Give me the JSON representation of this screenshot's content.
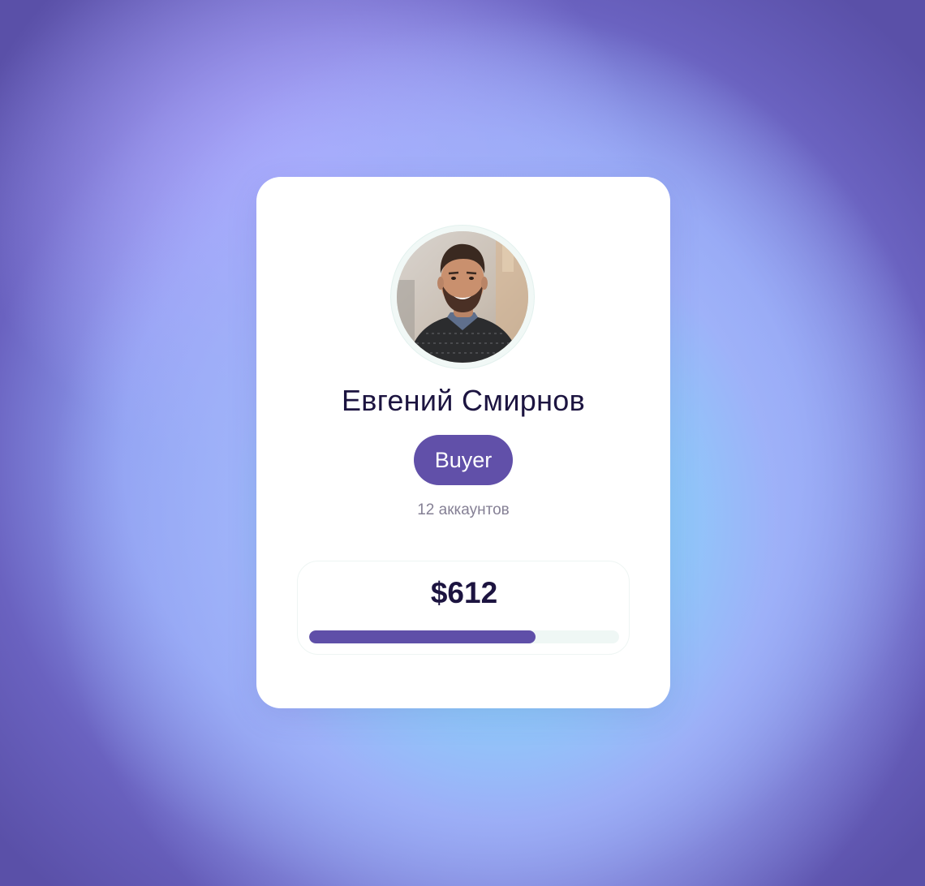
{
  "profile": {
    "name": "Евгений Смирнов",
    "role_badge": "Buyer",
    "accounts_text": "12 аккаунтов",
    "avatar_icon": "user-photo"
  },
  "balance": {
    "amount": "$612",
    "progress_fraction": 0.73
  },
  "colors": {
    "accent": "#6150a9",
    "text_dark": "#1c1440",
    "text_muted": "#858095",
    "track": "#eff7f5",
    "card": "#ffffff"
  }
}
